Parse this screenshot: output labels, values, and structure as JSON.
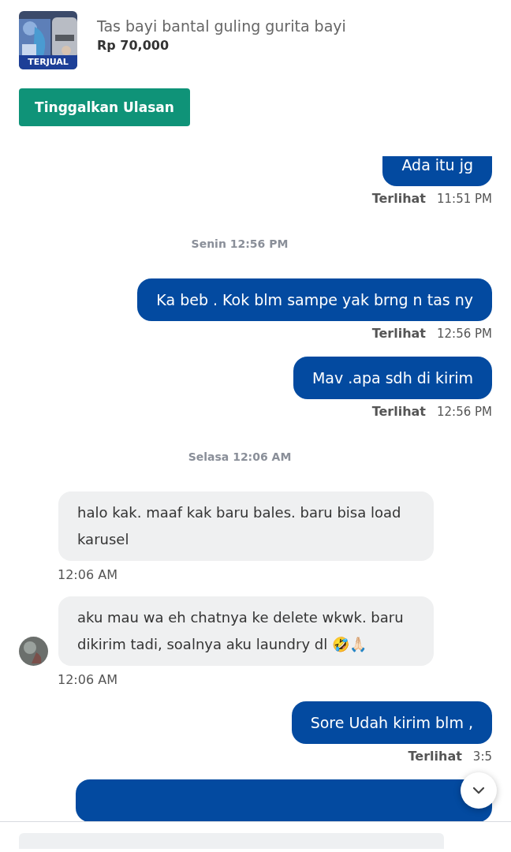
{
  "product": {
    "kind": "picture",
    "badge": "TERJUAL",
    "title": "Tas bayi bantal guling gurita bayi",
    "price": "Rp 70,000"
  },
  "review_button": "Tinggalkan Ulasan",
  "messages": [
    {
      "kind": "out",
      "text": "Ada itu jg",
      "status": "Terlihat",
      "time": "11:51 PM"
    },
    {
      "kind": "date",
      "text": "Senin 12:56 PM"
    },
    {
      "kind": "out",
      "text": "Ka beb . Kok blm sampe yak brng n tas ny",
      "status": "Terlihat",
      "time": "12:56 PM"
    },
    {
      "kind": "out",
      "text": "Mav .apa sdh di kirim",
      "status": "Terlihat",
      "time": "12:56 PM"
    },
    {
      "kind": "date",
      "text": "Selasa 12:06 AM"
    },
    {
      "kind": "in",
      "text": "halo kak. maaf kak baru bales. baru bisa load karusel",
      "time": "12:06 AM",
      "avatar": false
    },
    {
      "kind": "in",
      "text": "aku mau wa eh chatnya ke delete wkwk. baru dikirim tadi, soalnya aku laundry dl 🤣🙏🏻",
      "time": "12:06 AM",
      "avatar": true
    },
    {
      "kind": "out",
      "text": "Sore Udah kirim blm ,",
      "status": "Terlihat",
      "time": "3:5"
    },
    {
      "kind": "out"
    }
  ]
}
